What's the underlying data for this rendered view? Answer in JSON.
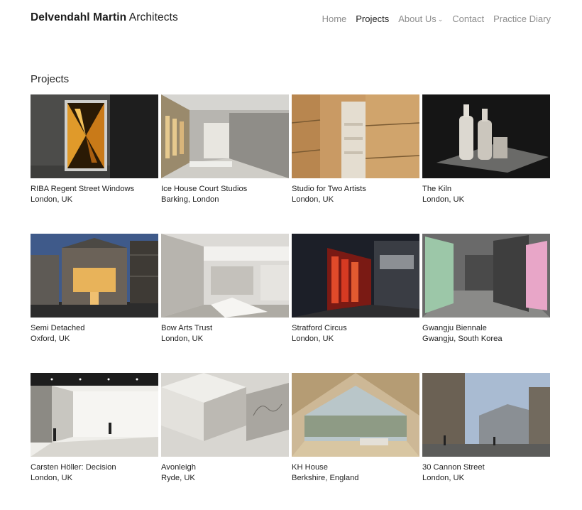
{
  "brand": {
    "bold": "Delvendahl Martin",
    "rest": "Architects"
  },
  "nav": {
    "items": [
      "Home",
      "Projects",
      "About Us",
      "Contact",
      "Practice Diary"
    ],
    "active": "Projects"
  },
  "section_title": "Projects",
  "projects": [
    {
      "title": "RIBA Regent Street Windows",
      "location": "London, UK",
      "image": "lit-window-installation"
    },
    {
      "title": "Ice House Court Studios",
      "location": "Barking, London",
      "image": "concrete-corridor-interior"
    },
    {
      "title": "Studio for Two Artists",
      "location": "London, UK",
      "image": "plywood-wall-interior"
    },
    {
      "title": "The Kiln",
      "location": "London, UK",
      "image": "white-kiln-model"
    },
    {
      "title": "Semi Detached",
      "location": "Oxford, UK",
      "image": "brick-house-facade-dusk"
    },
    {
      "title": "Bow Arts Trust",
      "location": "London, UK",
      "image": "white-gallery-interior"
    },
    {
      "title": "Stratford Circus",
      "location": "London, UK",
      "image": "red-lit-building-night"
    },
    {
      "title": "Gwangju Biennale",
      "location": "Gwangju, South Korea",
      "image": "exhibition-panels"
    },
    {
      "title": "Carsten Höller: Decision",
      "location": "London, UK",
      "image": "gallery-installation-hall"
    },
    {
      "title": "Avonleigh",
      "location": "Ryde, UK",
      "image": "white-architectural-model"
    },
    {
      "title": "KH House",
      "location": "Berkshire, England",
      "image": "timber-gable-interior"
    },
    {
      "title": "30 Cannon Street",
      "location": "London, UK",
      "image": "city-street-view"
    }
  ]
}
